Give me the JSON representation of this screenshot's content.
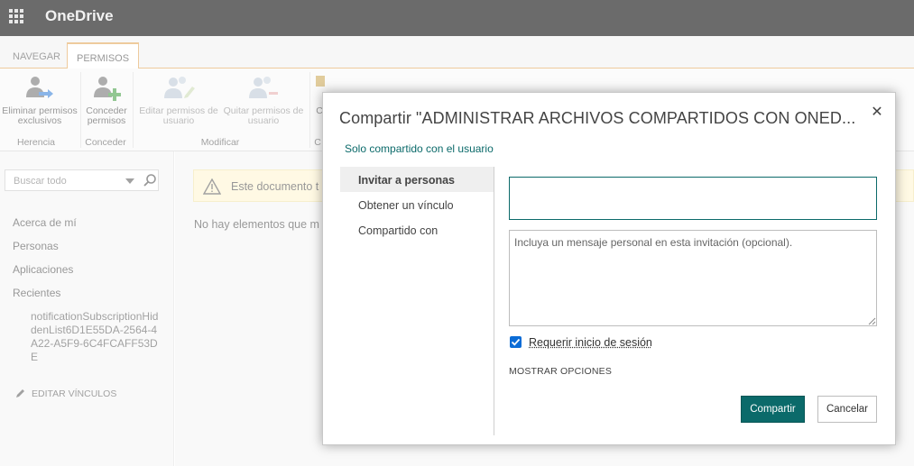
{
  "suite": {
    "brand": "OneDrive"
  },
  "tabs": [
    {
      "label": "NAVEGAR"
    },
    {
      "label": "PERMISOS"
    }
  ],
  "ribbon": {
    "buttons": [
      {
        "label_1": "Eliminar permisos",
        "label_2": "exclusivos"
      },
      {
        "label_1": "Conceder",
        "label_2": "permisos"
      },
      {
        "label_1": "Editar permisos de",
        "label_2": "usuario"
      },
      {
        "label_1": "Quitar permisos de",
        "label_2": "usuario"
      },
      {
        "label_1": "C"
      }
    ],
    "groups": [
      {
        "label": "Herencia"
      },
      {
        "label": "Conceder"
      },
      {
        "label": "Modificar"
      },
      {
        "label": "C"
      }
    ]
  },
  "leftnav": {
    "search_placeholder": "Buscar todo",
    "links": [
      "Acerca de mí",
      "Personas",
      "Aplicaciones",
      "Recientes"
    ],
    "recent_item": "notificationSubscriptionHiddenList6D1E55DA-2564-4A22-A5F9-6C4FCAFF53DE",
    "edit_links": "EDITAR VÍNCULOS"
  },
  "main": {
    "warning_text": "Este documento t",
    "empty_text": "No hay elementos que m"
  },
  "dialog": {
    "title": "Compartir \"ADMINISTRAR ARCHIVOS COMPARTIDOS CON ONED...",
    "close_glyph": "✕",
    "subtitle": "Solo compartido con el usuario",
    "nav": [
      {
        "label": "Invitar a personas"
      },
      {
        "label": "Obtener un vínculo"
      },
      {
        "label": "Compartido con"
      }
    ],
    "invite_value": "",
    "message_placeholder": "Incluya un mensaje personal en esta invitación (opcional).",
    "require_signin_label": "Requerir inicio de sesión",
    "require_signin_checked": true,
    "show_options": "MOSTRAR OPCIONES",
    "share_button": "Compartir",
    "cancel_button": "Cancelar"
  },
  "colors": {
    "accent": "#0b6a6a",
    "tab_accent": "#e1a04e",
    "suitebar": "#6b6b6b"
  }
}
